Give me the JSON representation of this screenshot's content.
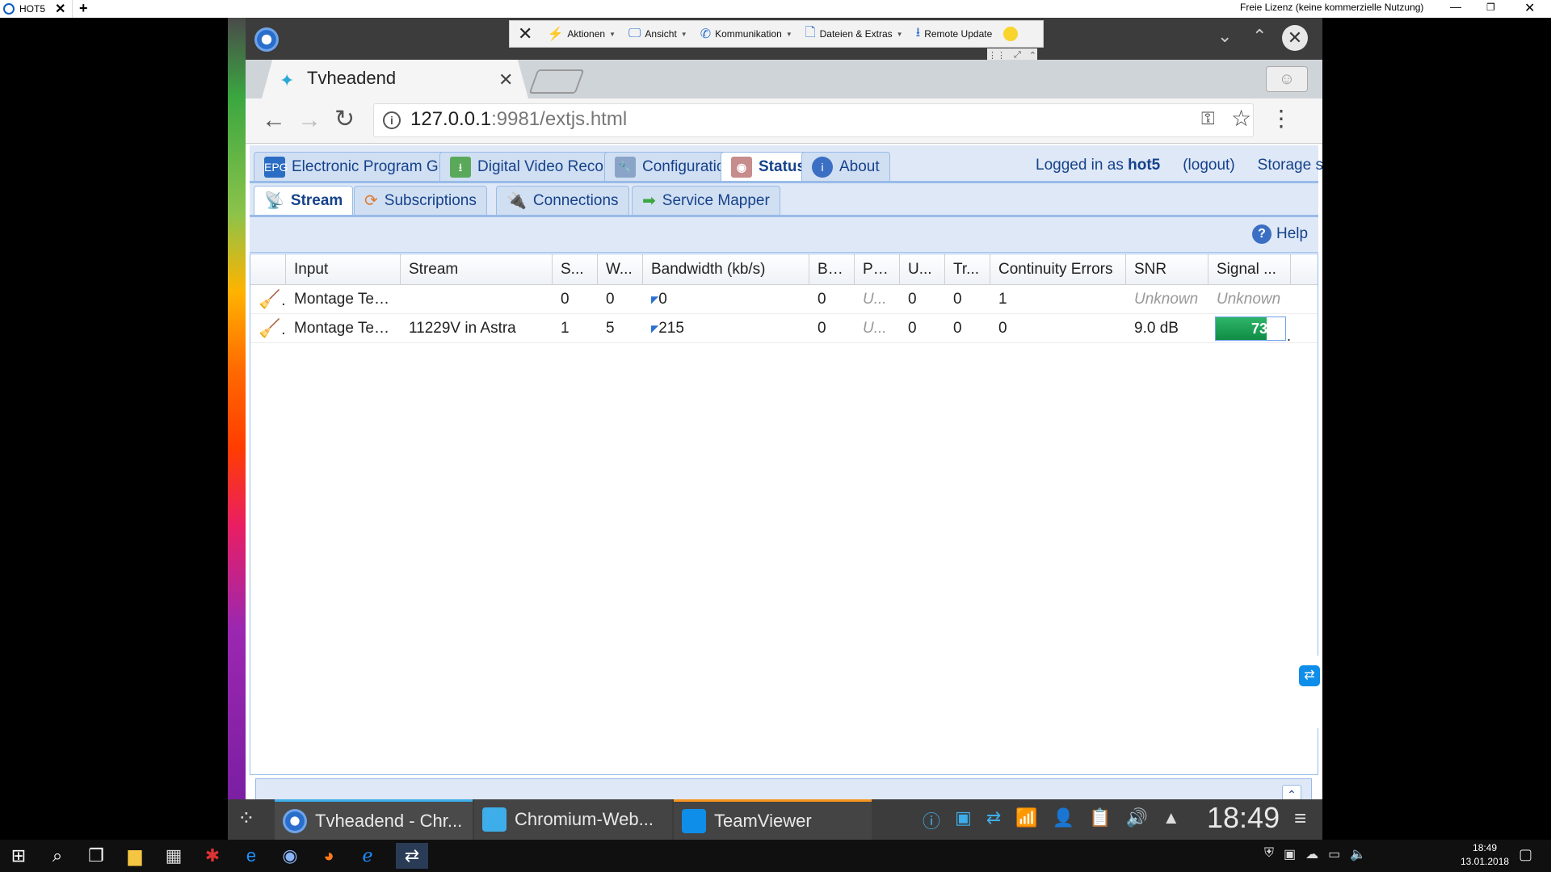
{
  "teamviewer": {
    "tab_label": "HOT5",
    "tab_close": "✕",
    "add_tab": "+",
    "license": "Freie Lizenz (keine kommerzielle Nutzung)",
    "toolbar": {
      "actions": "Aktionen",
      "view": "Ansicht",
      "communication": "Kommunikation",
      "files": "Dateien & Extras",
      "remote_update": "Remote Update"
    }
  },
  "browser": {
    "tab_title": "Tvheadend",
    "url_host": "127.0.0.1",
    "url_rest": ":9981/extjs.html"
  },
  "tvheadend": {
    "main_tabs": [
      {
        "label": "Electronic Program Guide"
      },
      {
        "label": "Digital Video Recorder"
      },
      {
        "label": "Configuration"
      },
      {
        "label": "Status"
      },
      {
        "label": "About"
      }
    ],
    "logged_in_prefix": "Logged in as",
    "username": "hot5",
    "logout": "(logout)",
    "storage": "Storage sp",
    "sub_tabs": [
      {
        "label": "Stream"
      },
      {
        "label": "Subscriptions"
      },
      {
        "label": "Connections"
      },
      {
        "label": "Service Mapper"
      }
    ],
    "help": "Help",
    "columns": [
      "Input",
      "Stream",
      "S...",
      "W...",
      "Bandwidth (kb/s)",
      "BER",
      "PER",
      "U...",
      "Tr...",
      "Continuity Errors",
      "SNR",
      "Signal ..."
    ],
    "rows": [
      {
        "input": "Montage Tec...",
        "stream": "",
        "s": "0",
        "w": "0",
        "bandwidth": "0",
        "ber": "0",
        "per": "U...",
        "u": "0",
        "tr": "0",
        "cc": "1",
        "snr": "Unknown",
        "signal": "Unknown"
      },
      {
        "input": "Montage Tec...",
        "stream": "11229V in Astra",
        "s": "1",
        "w": "5",
        "bandwidth": "215",
        "ber": "0",
        "per": "U...",
        "u": "0",
        "tr": "0",
        "cc": "0",
        "snr": "9.0 dB",
        "signal": "73%",
        "signal_fraction": 0.73
      }
    ]
  },
  "remote_taskbar": {
    "items": [
      "Tvheadend - Chr...",
      "Chromium-Web...",
      "TeamViewer"
    ],
    "clock": "18:49"
  },
  "windows_taskbar": {
    "time": "18:49",
    "date": "13.01.2018"
  }
}
